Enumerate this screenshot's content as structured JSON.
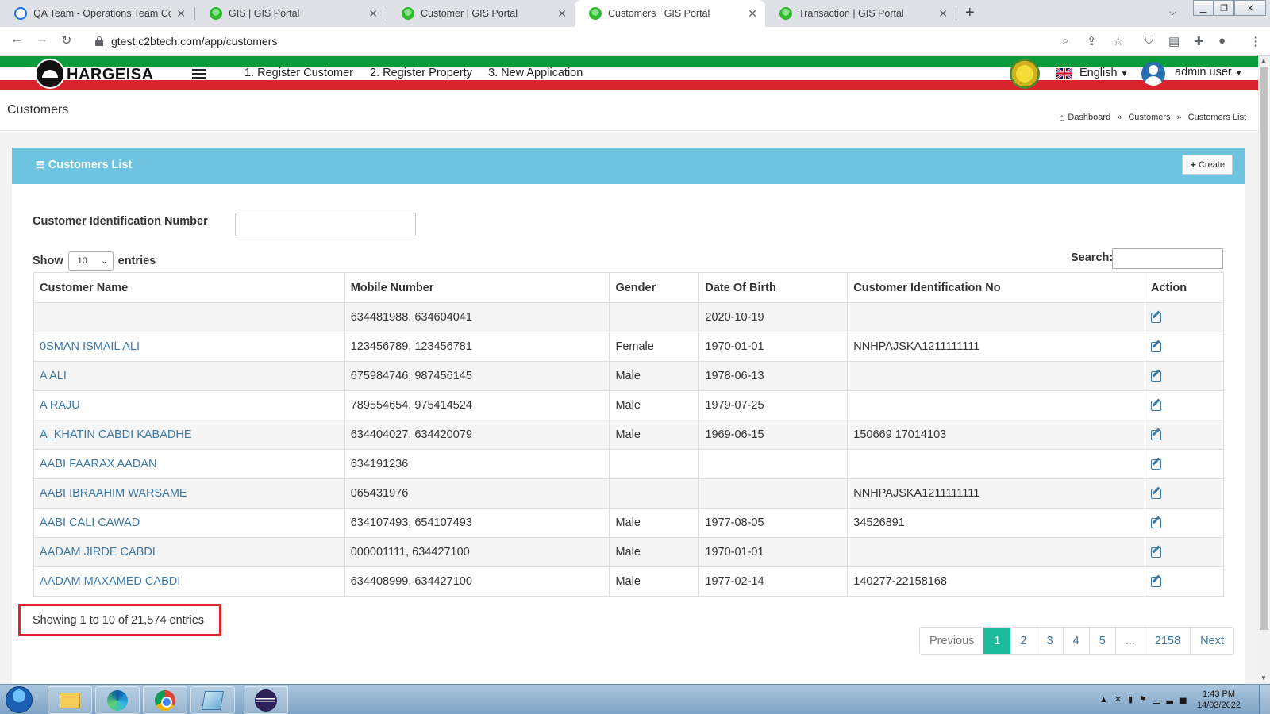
{
  "browser": {
    "tabs": [
      {
        "title": "QA Team - Operations Team Coll",
        "icon": "teams-icon"
      },
      {
        "title": "GIS | GIS Portal",
        "icon": "gis-favicon"
      },
      {
        "title": "Customer | GIS Portal",
        "icon": "gis-favicon"
      },
      {
        "title": "Customers | GIS Portal",
        "icon": "gis-favicon",
        "active": true
      },
      {
        "title": "Transaction | GIS Portal",
        "icon": "gis-favicon"
      }
    ],
    "url": "gtest.c2btech.com/app/customers"
  },
  "header": {
    "logo_text": "HARGEISA",
    "nav": [
      "1. Register Customer",
      "2. Register Property",
      "3. New Application"
    ],
    "language": "English",
    "user": "admin user",
    "colors": {
      "green": "#0a9a3e",
      "red": "#d9232d"
    }
  },
  "page": {
    "title": "Customers",
    "breadcrumb": [
      "Dashboard",
      "Customers",
      "Customers List"
    ]
  },
  "panel": {
    "title": "Customers List",
    "create_label": "Create",
    "filter_label": "Customer Identification Number",
    "show_label": "Show",
    "entries_value": "10",
    "entries_label": "entries",
    "search_label": "Search:"
  },
  "table": {
    "columns": [
      "Customer Name",
      "Mobile Number",
      "Gender",
      "Date Of Birth",
      "Customer Identification No",
      "Action"
    ],
    "rows": [
      {
        "name": "",
        "mobile": "634481988, 634604041",
        "gender": "",
        "dob": "2020-10-19",
        "cid": ""
      },
      {
        "name": "0SMAN ISMAIL ALI",
        "mobile": "123456789, 123456781",
        "gender": "Female",
        "dob": "1970-01-01",
        "cid": "NNHPAJSKA1211111111"
      },
      {
        "name": "A ALI",
        "mobile": "675984746, 987456145",
        "gender": "Male",
        "dob": "1978-06-13",
        "cid": ""
      },
      {
        "name": "A RAJU",
        "mobile": "789554654, 975414524",
        "gender": "Male",
        "dob": "1979-07-25",
        "cid": ""
      },
      {
        "name": "A_KHATIN CABDI KABADHE",
        "mobile": "634404027, 634420079",
        "gender": "Male",
        "dob": "1969-06-15",
        "cid": "150669 17014103"
      },
      {
        "name": "AABI FAARAX AADAN",
        "mobile": "634191236",
        "gender": "",
        "dob": "",
        "cid": ""
      },
      {
        "name": "AABI IBRAAHIM WARSAME",
        "mobile": "065431976",
        "gender": "",
        "dob": "",
        "cid": "NNHPAJSKA1211111111"
      },
      {
        "name": "AABI CALI CAWAD",
        "mobile": "634107493, 654107493",
        "gender": "Male",
        "dob": "1977-08-05",
        "cid": "34526891"
      },
      {
        "name": "AADAM JIRDE CABDI",
        "mobile": "000001111, 634427100",
        "gender": "Male",
        "dob": "1970-01-01",
        "cid": ""
      },
      {
        "name": "AADAM MAXAMED CABDI",
        "mobile": "634408999, 634427100",
        "gender": "Male",
        "dob": "1977-02-14",
        "cid": "140277-22158168"
      }
    ]
  },
  "footer": {
    "info": "Showing 1 to 10 of 21,574 entries",
    "pagination": {
      "previous": "Previous",
      "pages": [
        "1",
        "2",
        "3",
        "4",
        "5",
        "...",
        "2158"
      ],
      "active": "1",
      "next": "Next"
    }
  },
  "taskbar": {
    "time": "1:43 PM",
    "date": "14/03/2022"
  }
}
